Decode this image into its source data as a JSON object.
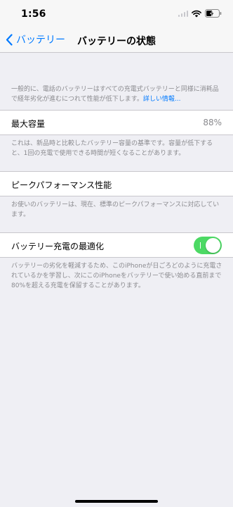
{
  "status_bar": {
    "time": "1:56",
    "icons": [
      "signal-icon",
      "wifi-icon",
      "battery-charging-icon"
    ]
  },
  "nav": {
    "back_label": "バッテリー",
    "title": "バッテリーの状態"
  },
  "intro": {
    "text": "一般的に、電話のバッテリーはすべての充電式バッテリーと同様に消耗品で経年劣化が進むにつれて性能が低下します。",
    "link": "詳しい情報..."
  },
  "max_capacity": {
    "label": "最大容量",
    "value": "88%",
    "note": "これは、新品時と比較したバッテリー容量の基準です。容量が低下すると、1回の充電で使用できる時間が短くなることがあります。"
  },
  "peak_performance": {
    "label": "ピークパフォーマンス性能",
    "note": "お使いのバッテリーは、現在、標準のピークパフォーマンスに対応しています。"
  },
  "optimized_charging": {
    "label": "バッテリー充電の最適化",
    "enabled": true,
    "note": "バッテリーの劣化を軽減するため、このiPhoneが日ごろどのように充電されているかを学習し、次にこのiPhoneをバッテリーで使い始める直前まで80%を超える充電を保留することがあります。"
  },
  "colors": {
    "accent": "#007aff",
    "toggle_on": "#4cd964",
    "background": "#efeff4",
    "secondary_text": "#8a8a8e"
  }
}
